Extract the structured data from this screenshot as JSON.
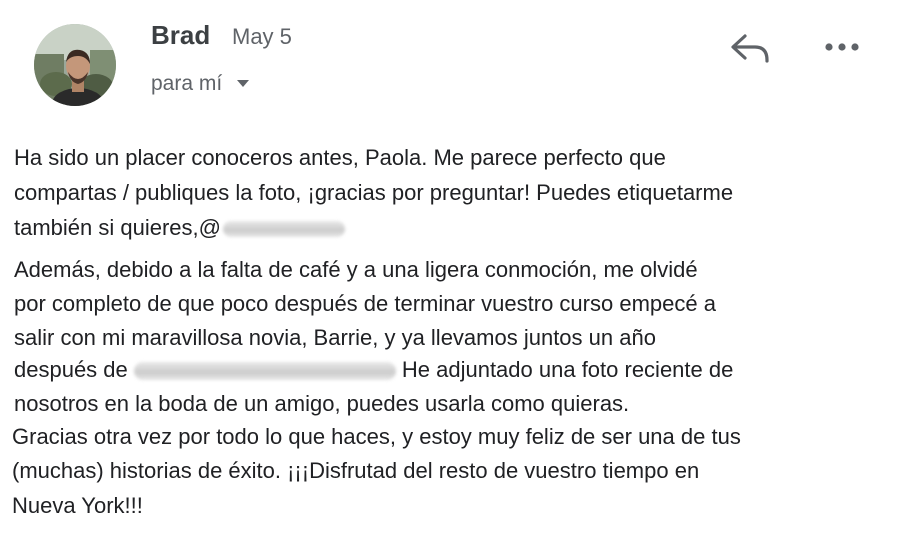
{
  "header": {
    "sender": "Brad",
    "date": "May 5",
    "recipient": "para mí"
  },
  "icons": {
    "avatar": "avatar",
    "reply": "reply-icon",
    "more": "more-vert-icon",
    "caret": "caret-down-icon"
  },
  "colors": {
    "text": "#202124",
    "secondary": "#5f6368",
    "icon": "#5f6368"
  },
  "message": {
    "para1": {
      "line1": "Ha sido un placer conoceros antes,  Paola. Me parece perfecto que",
      "line2": "compartas / publiques la foto, ¡gracias por preguntar! Puedes etiquetarme",
      "line3": "también si quieres,",
      "line3_at": "@"
    },
    "para2": {
      "line1": "Además, debido a la falta de café y a una ligera conmoción, me olvidé",
      "line2": "por completo de que poco después de terminar vuestro curso empecé a",
      "line3": "salir con mi maravillosa novia, Barrie, y ya llevamos juntos un año",
      "line4_start": "después de",
      "line4_end": " He adjuntado una foto reciente de",
      "line5": "nosotros en la boda de un amigo, puedes usarla como quieras."
    },
    "para3": {
      "line1": "Gracias otra vez por todo lo que haces, y estoy muy feliz de ser una de tus",
      "line2": "(muchas) historias de éxito. ¡¡¡Disfrutad del resto de vuestro tiempo en",
      "line3": "Nueva York!!!"
    }
  }
}
